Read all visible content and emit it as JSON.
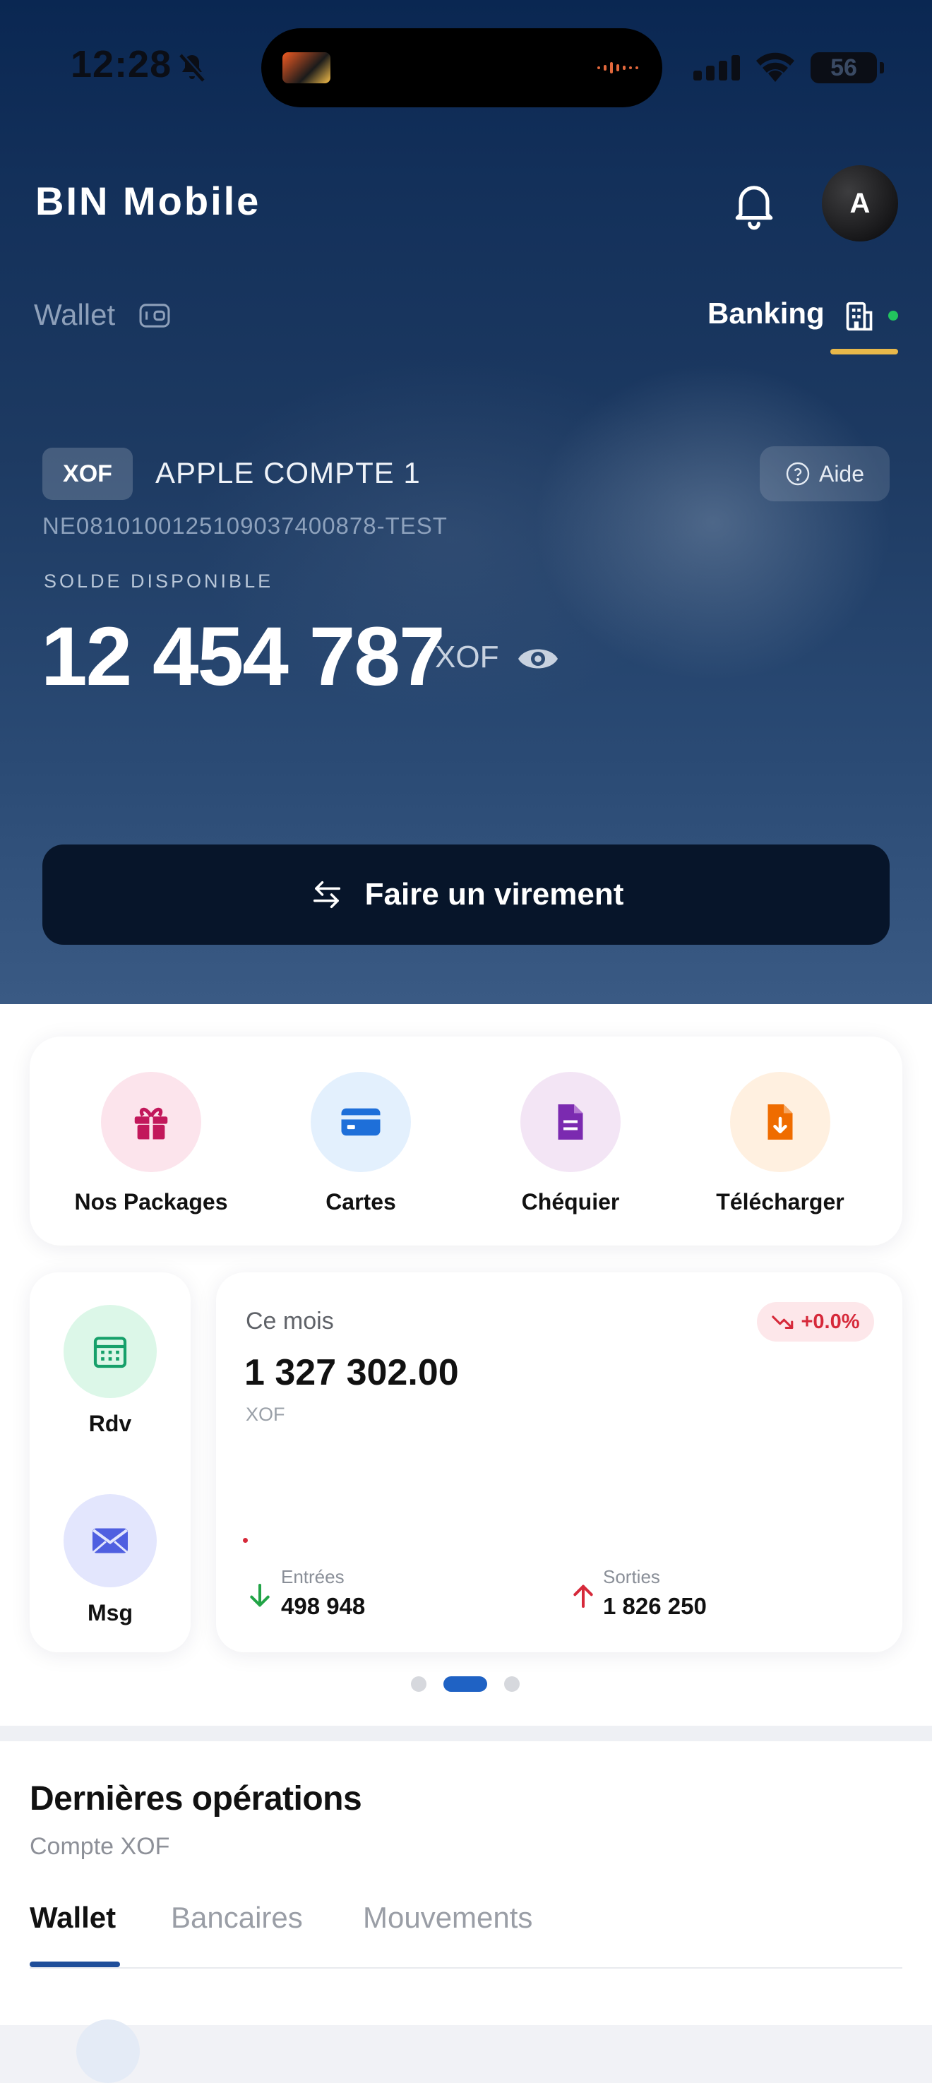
{
  "status_bar": {
    "time": "12:28",
    "battery": "56"
  },
  "header": {
    "app_title": "BIN Mobile",
    "avatar_initial": "A"
  },
  "mode_tabs": {
    "wallet": "Wallet",
    "banking": "Banking"
  },
  "account": {
    "currency": "XOF",
    "name": "APPLE COMPTE 1",
    "help_label": "Aide",
    "iban": "NE0810100125109037400878-TEST",
    "balance_label": "SOLDE DISPONIBLE",
    "balance": "12 454 787",
    "balance_currency": "XOF"
  },
  "transfer_button": "Faire un virement",
  "quick_actions": [
    {
      "label": "Nos Packages",
      "icon": "gift-icon",
      "bg": "#fce4ec",
      "color": "#c2185b"
    },
    {
      "label": "Cartes",
      "icon": "credit-card-icon",
      "bg": "#e3f0fd",
      "color": "#1e6fd9"
    },
    {
      "label": "Chéquier",
      "icon": "document-icon",
      "bg": "#f3e5f5",
      "color": "#7b2ab0"
    },
    {
      "label": "Télécharger",
      "icon": "download-icon",
      "bg": "#fff0e0",
      "color": "#ef6c00"
    }
  ],
  "side_actions": [
    {
      "label": "Rdv",
      "icon": "calendar-icon",
      "bg": "#dcf7e8",
      "color": "#16a06a"
    },
    {
      "label": "Msg",
      "icon": "mail-icon",
      "bg": "#e3e6fd",
      "color": "#4f5fe0"
    }
  ],
  "month_summary": {
    "title": "Ce mois",
    "change": "+0.0%",
    "amount": "1 327 302.00",
    "currency": "XOF",
    "in_label": "Entrées",
    "in_value": "498 948",
    "out_label": "Sorties",
    "out_value": "1 826 250"
  },
  "pager": {
    "pages": 3,
    "active": 1
  },
  "operations": {
    "title": "Dernières opérations",
    "subtitle": "Compte XOF",
    "tabs": [
      "Wallet",
      "Bancaires",
      "Mouvements"
    ],
    "active_tab": 0
  },
  "colors": {
    "accent": "#1f4e9a",
    "gold": "#e8b84a",
    "online": "#22c55e",
    "negative": "#d6293a",
    "positive": "#22a447"
  }
}
